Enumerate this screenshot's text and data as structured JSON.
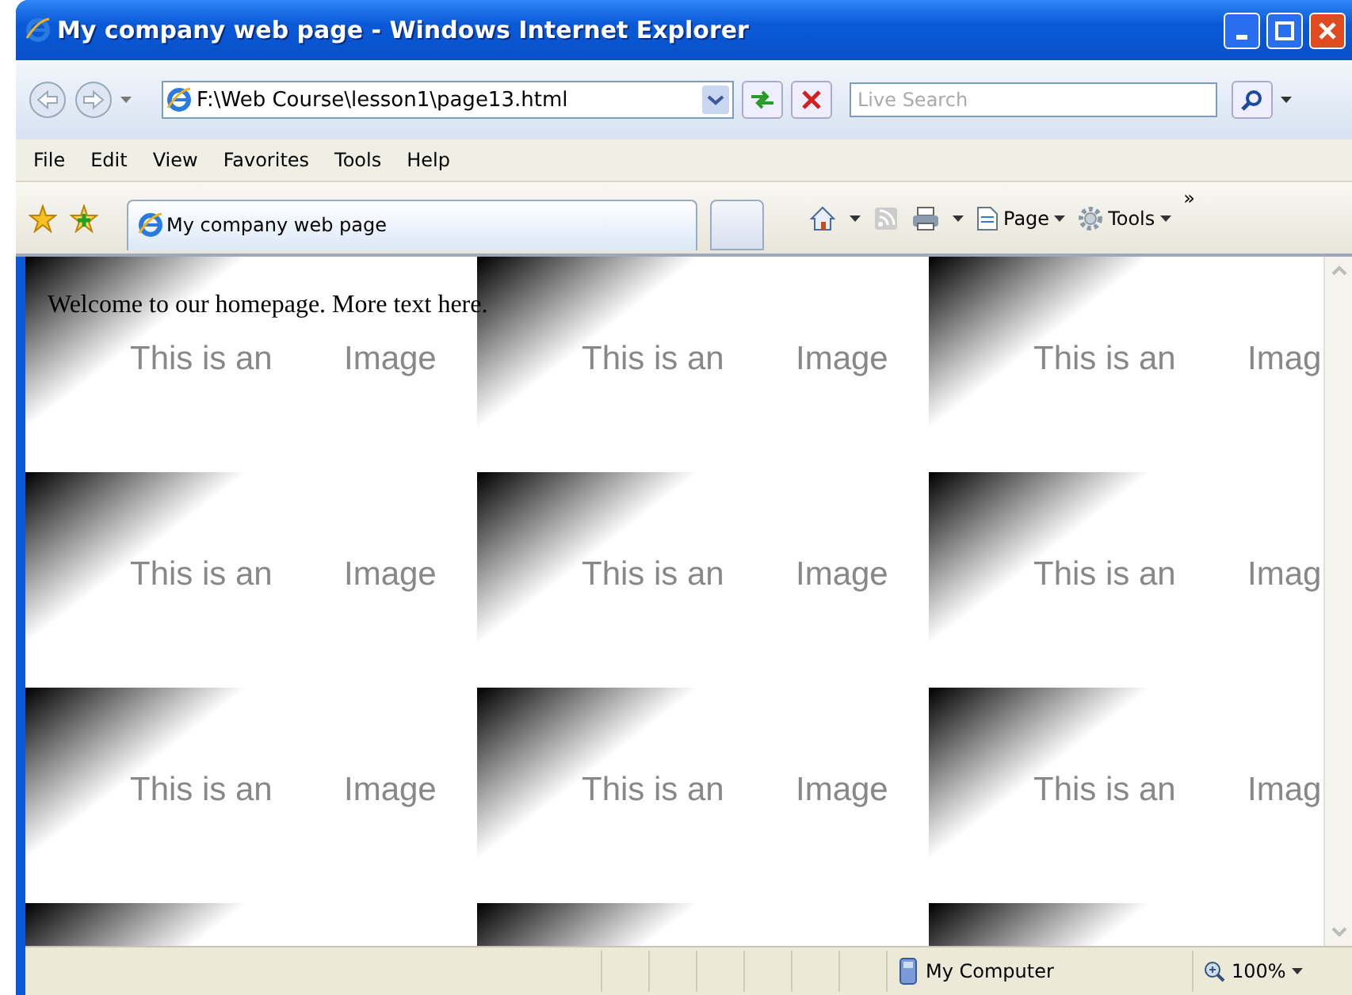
{
  "window": {
    "title": "My company web page - Windows Internet Explorer"
  },
  "address_bar": {
    "value": "F:\\Web Course\\lesson1\\page13.html"
  },
  "search": {
    "placeholder": "Live Search"
  },
  "menu": [
    "File",
    "Edit",
    "View",
    "Favorites",
    "Tools",
    "Help"
  ],
  "tabs": [
    {
      "label": "My company web page",
      "selected": true
    }
  ],
  "toolbar": {
    "buttons": [
      {
        "label": "Page",
        "kind": "page"
      },
      {
        "label": "Tools",
        "kind": "tools"
      }
    ],
    "overflow": "»"
  },
  "page": {
    "text": "Welcome to our homepage. More text here.",
    "tiles": [
      {
        "texts": [
          "This is an",
          "Image"
        ]
      },
      {
        "texts": [
          "This is an",
          "Image"
        ]
      },
      {
        "texts": [
          "This is an",
          "Imag"
        ]
      },
      {
        "texts": [
          "This is an",
          "Image"
        ]
      },
      {
        "texts": [
          "This is an",
          "Image"
        ]
      },
      {
        "texts": [
          "This is an",
          "Imag"
        ]
      },
      {
        "texts": [
          "This is an",
          "Image"
        ]
      },
      {
        "texts": [
          "This is an",
          "Image"
        ]
      },
      {
        "texts": [
          "This is an",
          "Imag"
        ]
      }
    ]
  },
  "status_bar": {
    "zone": "My Computer",
    "zoom": "100%"
  }
}
